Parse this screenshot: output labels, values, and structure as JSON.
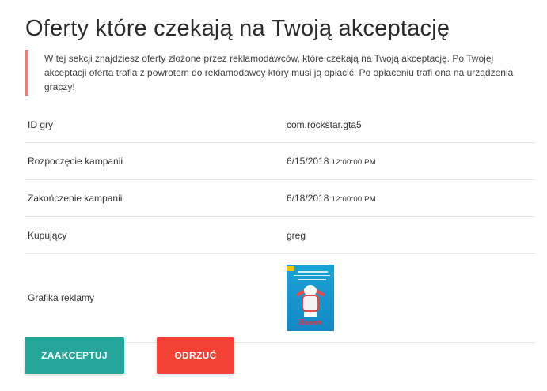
{
  "page": {
    "title": "Oferty które czekają na Twoją akceptację",
    "description": "W tej sekcji znajdziesz oferty złożone przez reklamodawców, które czekają na Twoją akceptację. Po Twojej akceptacji oferta trafia z powrotem do reklamodawcy który musi ją opłacić. Po opłaceniu trafi ona na urządzenia graczy!"
  },
  "details": {
    "game_id_label": "ID gry",
    "game_id_value": "com.rockstar.gta5",
    "start_label": "Rozpoczęcie kampanii",
    "start_date": "6/15/2018",
    "start_time": "12:00:00 PM",
    "end_label": "Zakończenie kampanii",
    "end_date": "6/18/2018",
    "end_time": "12:00:00 PM",
    "buyer_label": "Kupujący",
    "buyer_value": "greg",
    "ad_image_label": "Grafika reklamy",
    "ad_image_text": "Boom"
  },
  "actions": {
    "accept_label": "ZAAKCEPTUJ",
    "reject_label": "ODRZUĆ"
  },
  "colors": {
    "accent_border": "#ef7b7b",
    "accept_button": "#26a69a",
    "reject_button": "#f44336"
  }
}
